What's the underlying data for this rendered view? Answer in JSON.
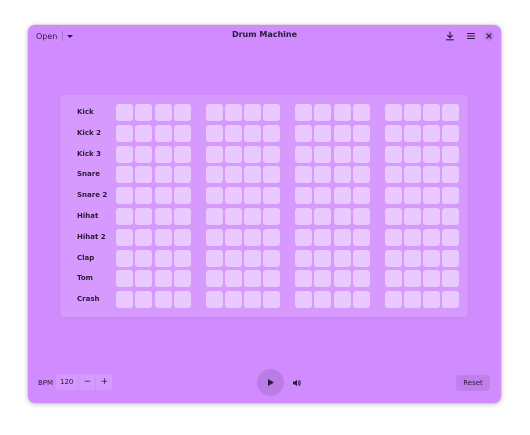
{
  "window": {
    "title": "Drum Machine",
    "open_label": "Open",
    "header_icons": [
      "download-icon",
      "hamburger-menu-icon",
      "close-icon"
    ]
  },
  "sequencer": {
    "steps": 16,
    "rows": [
      {
        "label": "Kick",
        "active_steps": []
      },
      {
        "label": "Kick 2",
        "active_steps": []
      },
      {
        "label": "Kick 3",
        "active_steps": []
      },
      {
        "label": "Snare",
        "active_steps": []
      },
      {
        "label": "Snare 2",
        "active_steps": []
      },
      {
        "label": "Hihat",
        "active_steps": []
      },
      {
        "label": "Hihat 2",
        "active_steps": []
      },
      {
        "label": "Clap",
        "active_steps": []
      },
      {
        "label": "Tom",
        "active_steps": []
      },
      {
        "label": "Crash",
        "active_steps": []
      }
    ]
  },
  "footer": {
    "bpm_label": "BPM",
    "bpm_value": "120",
    "decrement": "−",
    "increment": "+",
    "play_icon": "play-icon",
    "volume_icon": "volume-icon",
    "reset_label": "Reset"
  },
  "colors": {
    "window_bg": "#d08bff",
    "pad_inactive": "#e9c9ff",
    "pad_active": "#7b2fbf",
    "text": "#2a1a38"
  }
}
